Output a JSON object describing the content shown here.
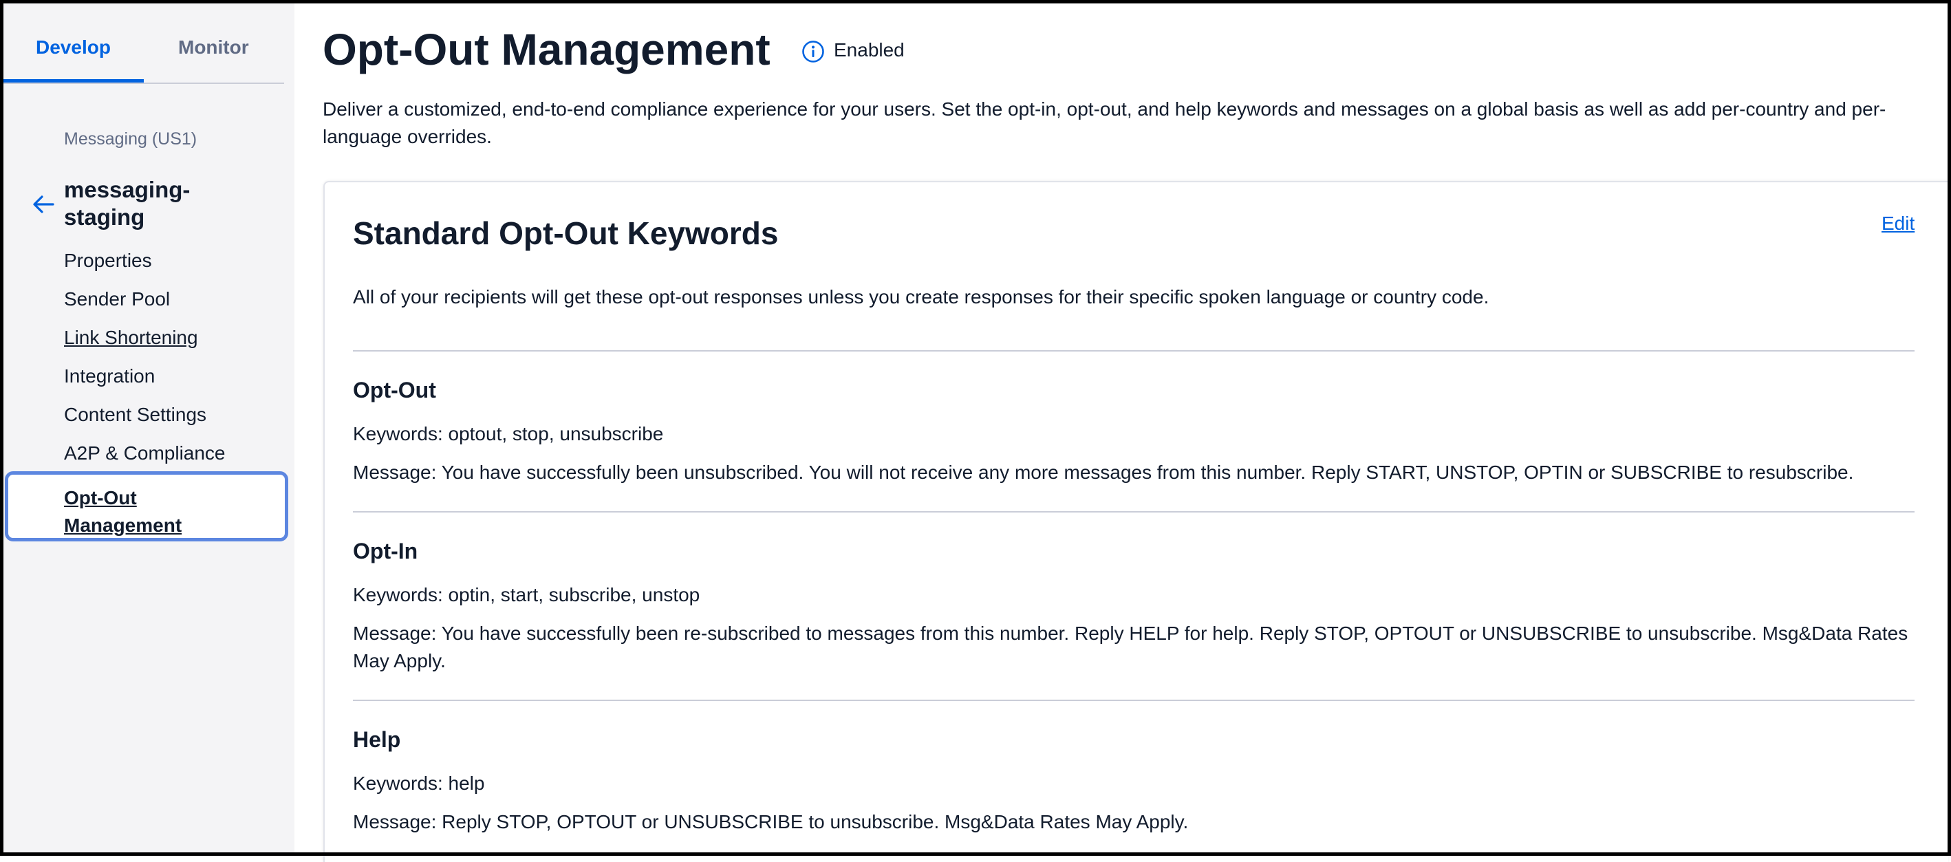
{
  "sidebar": {
    "tabs": [
      {
        "label": "Develop"
      },
      {
        "label": "Monitor"
      }
    ],
    "service_label": "Messaging (US1)",
    "service_name": "messaging-staging",
    "nav_items": [
      {
        "label": "Properties"
      },
      {
        "label": "Sender Pool"
      },
      {
        "label": "Link Shortening"
      },
      {
        "label": "Integration"
      },
      {
        "label": "Content Settings"
      },
      {
        "label": "A2P & Compliance"
      },
      {
        "label": "Opt-Out Management"
      }
    ],
    "active_item": "Opt-Out Management"
  },
  "header": {
    "title": "Opt-Out Management",
    "status": "Enabled",
    "status_icon": "info-icon",
    "description": "Deliver a customized, end-to-end compliance experience for your users. Set the opt-in, opt-out, and help keywords and messages on a global basis as well as add per-country and per-language overrides."
  },
  "card": {
    "title": "Standard Opt-Out Keywords",
    "edit_label": "Edit",
    "description": "All of your recipients will get these opt-out responses unless you create responses for their specific spoken language or country code.",
    "sections": [
      {
        "title": "Opt-Out",
        "keywords": "Keywords: optout, stop, unsubscribe",
        "message": "Message: You have successfully been unsubscribed. You will not receive any more messages from this number. Reply START, UNSTOP, OPTIN or SUBSCRIBE to resubscribe."
      },
      {
        "title": "Opt-In",
        "keywords": "Keywords: optin, start, subscribe, unstop",
        "message": "Message: You have successfully been re-subscribed to messages from this number. Reply HELP for help. Reply STOP, OPTOUT or UNSUBSCRIBE to unsubscribe. Msg&Data Rates May Apply."
      },
      {
        "title": "Help",
        "keywords": "Keywords: help",
        "message": "Message: Reply STOP, OPTOUT or UNSUBSCRIBE to unsubscribe. Msg&Data Rates May Apply."
      }
    ]
  },
  "colors": {
    "accent": "#0263e0",
    "active_border": "#5c86e0",
    "sidebar_bg": "#f4f4f6",
    "text": "#121c2d",
    "muted": "#606b85"
  }
}
